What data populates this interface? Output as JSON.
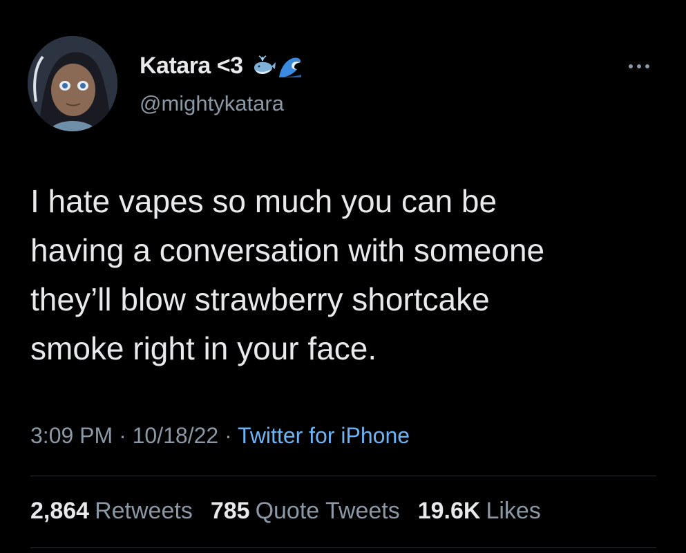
{
  "user": {
    "display_name": "Katara <3",
    "handle": "@mightykatara",
    "name_emojis": [
      "whale-icon",
      "wave-icon"
    ]
  },
  "tweet": {
    "lines": [
      "I hate vapes so much you can be",
      "having a conversation with someone",
      "they’ll blow strawberry shortcake",
      "smoke right in your face."
    ]
  },
  "meta": {
    "time": "3:09 PM",
    "separator": " · ",
    "date": "10/18/22",
    "source": "Twitter for iPhone"
  },
  "stats": {
    "retweets_count": "2,864",
    "retweets_label": "Retweets",
    "quotes_count": "785",
    "quotes_label": "Quote Tweets",
    "likes_count": "19.6K",
    "likes_label": "Likes"
  },
  "colors": {
    "background": "#000000",
    "primary_text": "#e7e9ea",
    "secondary_text": "#8b98a5",
    "link": "#6cb4f5",
    "divider": "#2f3336"
  }
}
